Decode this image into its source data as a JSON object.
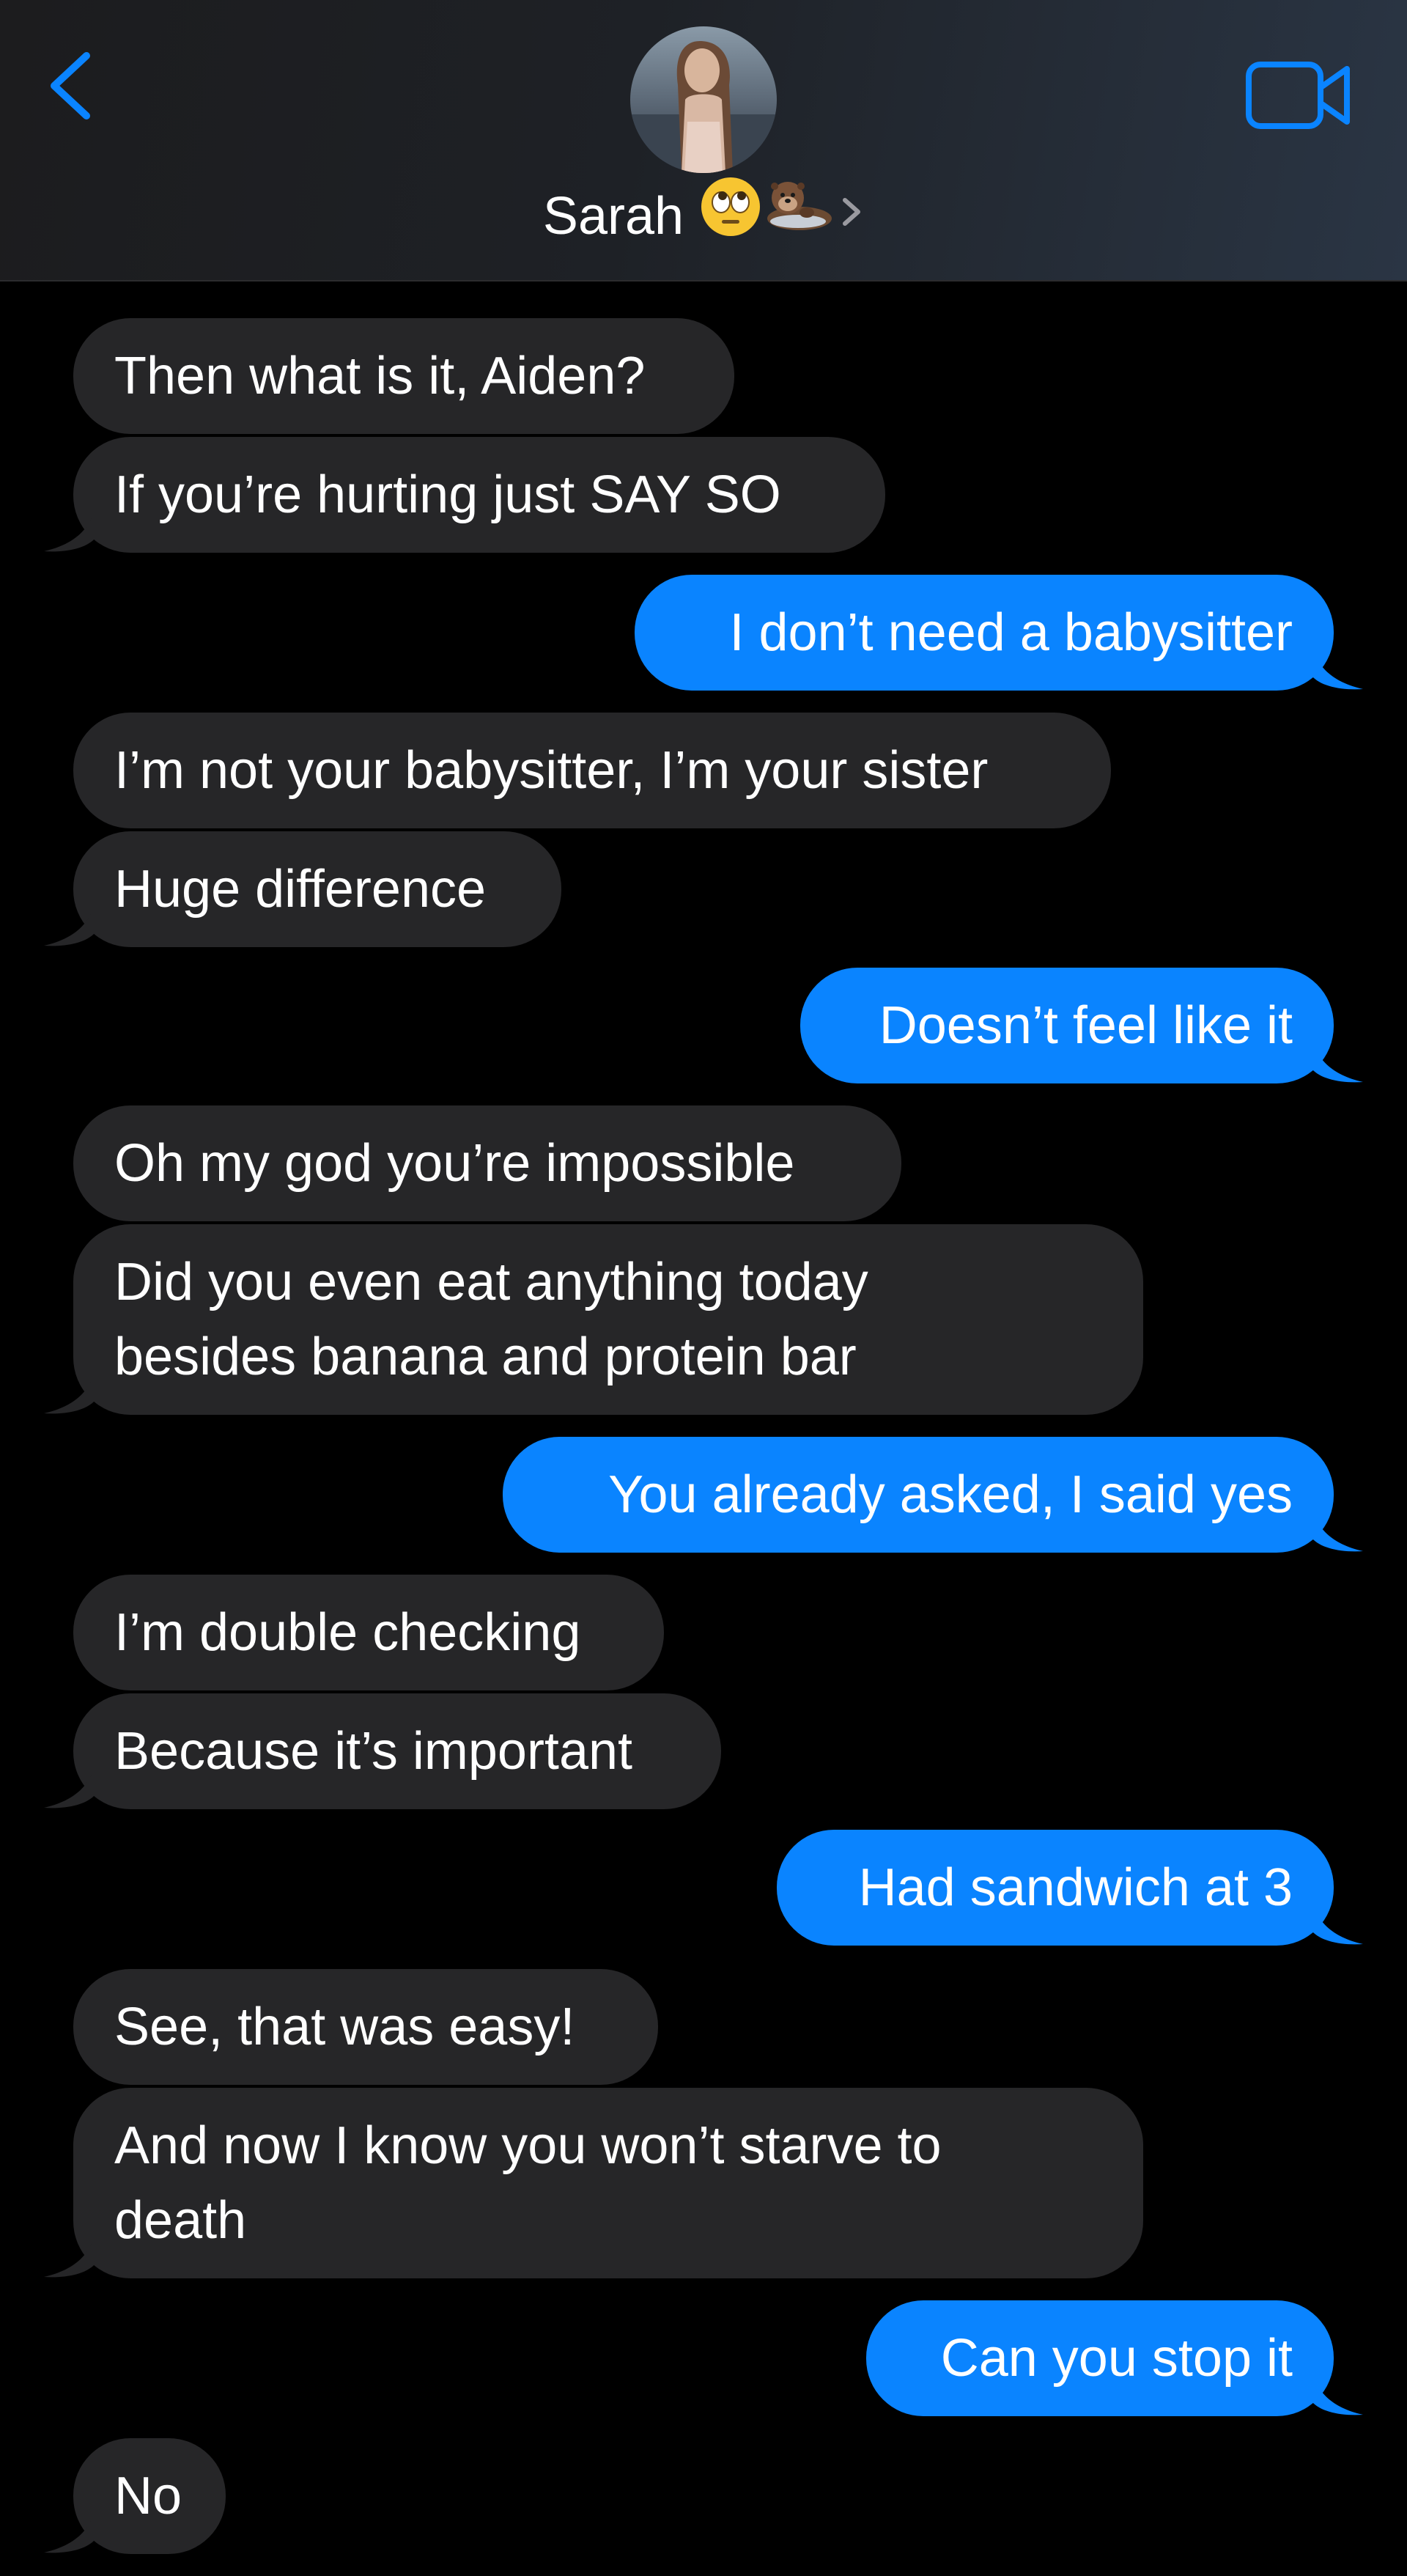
{
  "header": {
    "contact_name": "Sarah",
    "contact_emojis": [
      "face-with-rolling-eyes",
      "otter"
    ],
    "back_icon": "chevron-left-icon",
    "video_icon": "video-camera-icon",
    "accent_color": "#0a84ff"
  },
  "messages": [
    {
      "side": "in",
      "text": "Then what is it, Aiden?"
    },
    {
      "side": "in",
      "text": "If you’re hurting just SAY SO"
    },
    {
      "side": "out",
      "text": "I don’t need a babysitter"
    },
    {
      "side": "in",
      "text": "I’m not your babysitter, I’m your sister"
    },
    {
      "side": "in",
      "text": "Huge difference"
    },
    {
      "side": "out",
      "text": "Doesn’t feel like it"
    },
    {
      "side": "in",
      "text": "Oh my god you’re impossible"
    },
    {
      "side": "in",
      "text": "Did you even eat anything today\nbesides banana and protein bar"
    },
    {
      "side": "out",
      "text": "You already asked, I said yes"
    },
    {
      "side": "in",
      "text": "I’m double checking"
    },
    {
      "side": "in",
      "text": "Because it’s important"
    },
    {
      "side": "out",
      "text": "Had sandwich at 3"
    },
    {
      "side": "in",
      "text": "See, that was easy!"
    },
    {
      "side": "in",
      "text": "And now I know you won’t starve to\ndeath"
    },
    {
      "side": "out",
      "text": "Can you stop it"
    },
    {
      "side": "in",
      "text": "No"
    }
  ],
  "colors": {
    "incoming_bubble": "#262628",
    "outgoing_bubble": "#0a84ff",
    "background": "#000000"
  }
}
